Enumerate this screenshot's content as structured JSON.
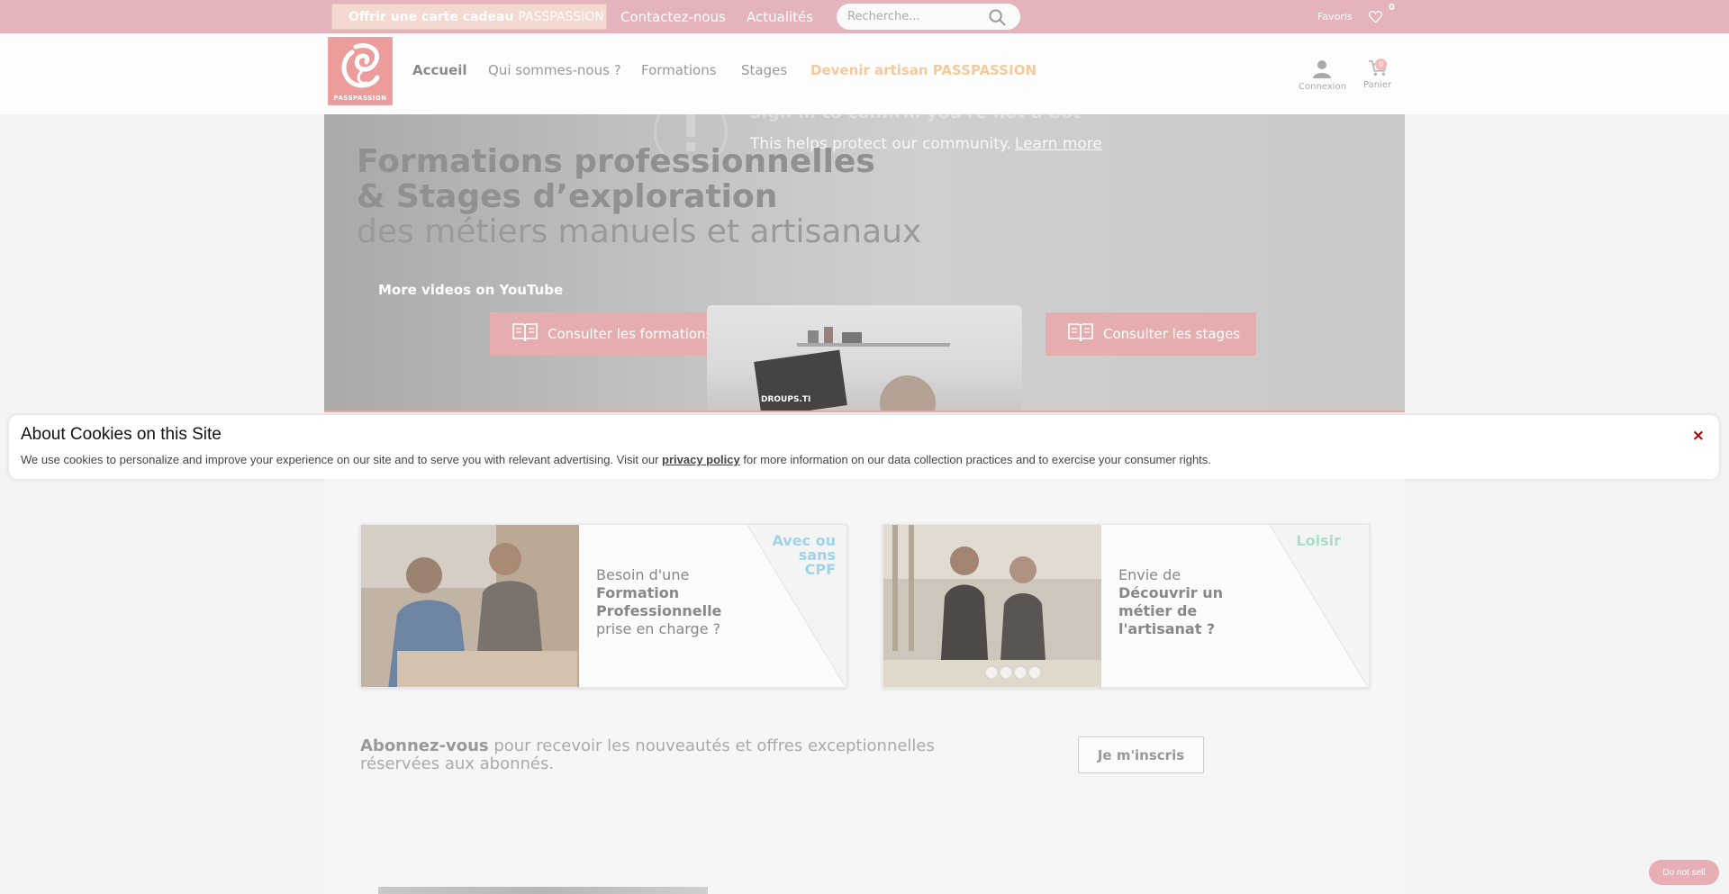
{
  "topbar": {
    "gift_bold": "Offrir une carte cadeau",
    "gift_brand": "PASSPASSION",
    "contact": "Contactez-nous",
    "news": "Actualités",
    "search_placeholder": "Recherche...",
    "favorites_label": "Favoris",
    "favorites_count": "0"
  },
  "header": {
    "logo_text": "PASSPASSION",
    "nav": [
      {
        "label": "Accueil"
      },
      {
        "label": "Qui sommes-nous ?"
      },
      {
        "label": "Formations"
      },
      {
        "label": "Stages"
      },
      {
        "label": "Devenir artisan PASSPASSION"
      }
    ],
    "login_label": "Connexion",
    "cart_label": "Panier",
    "cart_count": "0"
  },
  "hero": {
    "yt_title": "Sign in to confirm you're not a bot",
    "yt_help": "This helps protect our community.",
    "yt_learn_more": "Learn more",
    "line1": "Formations professionnelles",
    "line2": "& Stages d’exploration",
    "line3": "des métiers manuels et artisanaux",
    "more_videos": "More videos on YouTube",
    "btn_formations": "Consulter les formations",
    "btn_stages": "Consulter les stages",
    "video_text": "DROUPS.TI"
  },
  "cookie": {
    "title": "About Cookies on this Site",
    "text_before": "We use cookies to personalize and improve your experience on our site and to serve you with relevant advertising. Visit our",
    "link": "privacy policy",
    "text_after": "for more information on our data collection practices and to exercise your consumer rights.",
    "close": "×"
  },
  "cards": [
    {
      "tag1": "Avec ou",
      "tag2": "sans",
      "tag3": "CPF",
      "tag_color": "#9fd3ea",
      "t1": "Besoin d'une",
      "t2": "Formation",
      "t3": "Professionnelle",
      "t4": "prise en charge ?"
    },
    {
      "tag1": "Loisir",
      "tag_color": "#a8dfc6",
      "t1": "Envie de",
      "t2": "Découvrir un",
      "t3": "métier de",
      "t4": "l'artisanat ?"
    }
  ],
  "subscribe": {
    "bold": "Abonnez-vous",
    "text": "pour recevoir les nouveautés et offres exceptionnelles réservées aux abonnés.",
    "button": "Je m'inscris"
  },
  "do_not_sell": "Do not sell",
  "colors": {
    "topbar": "#e5b3bb",
    "accent": "#e6adaf",
    "artisan": "#f5c999"
  }
}
